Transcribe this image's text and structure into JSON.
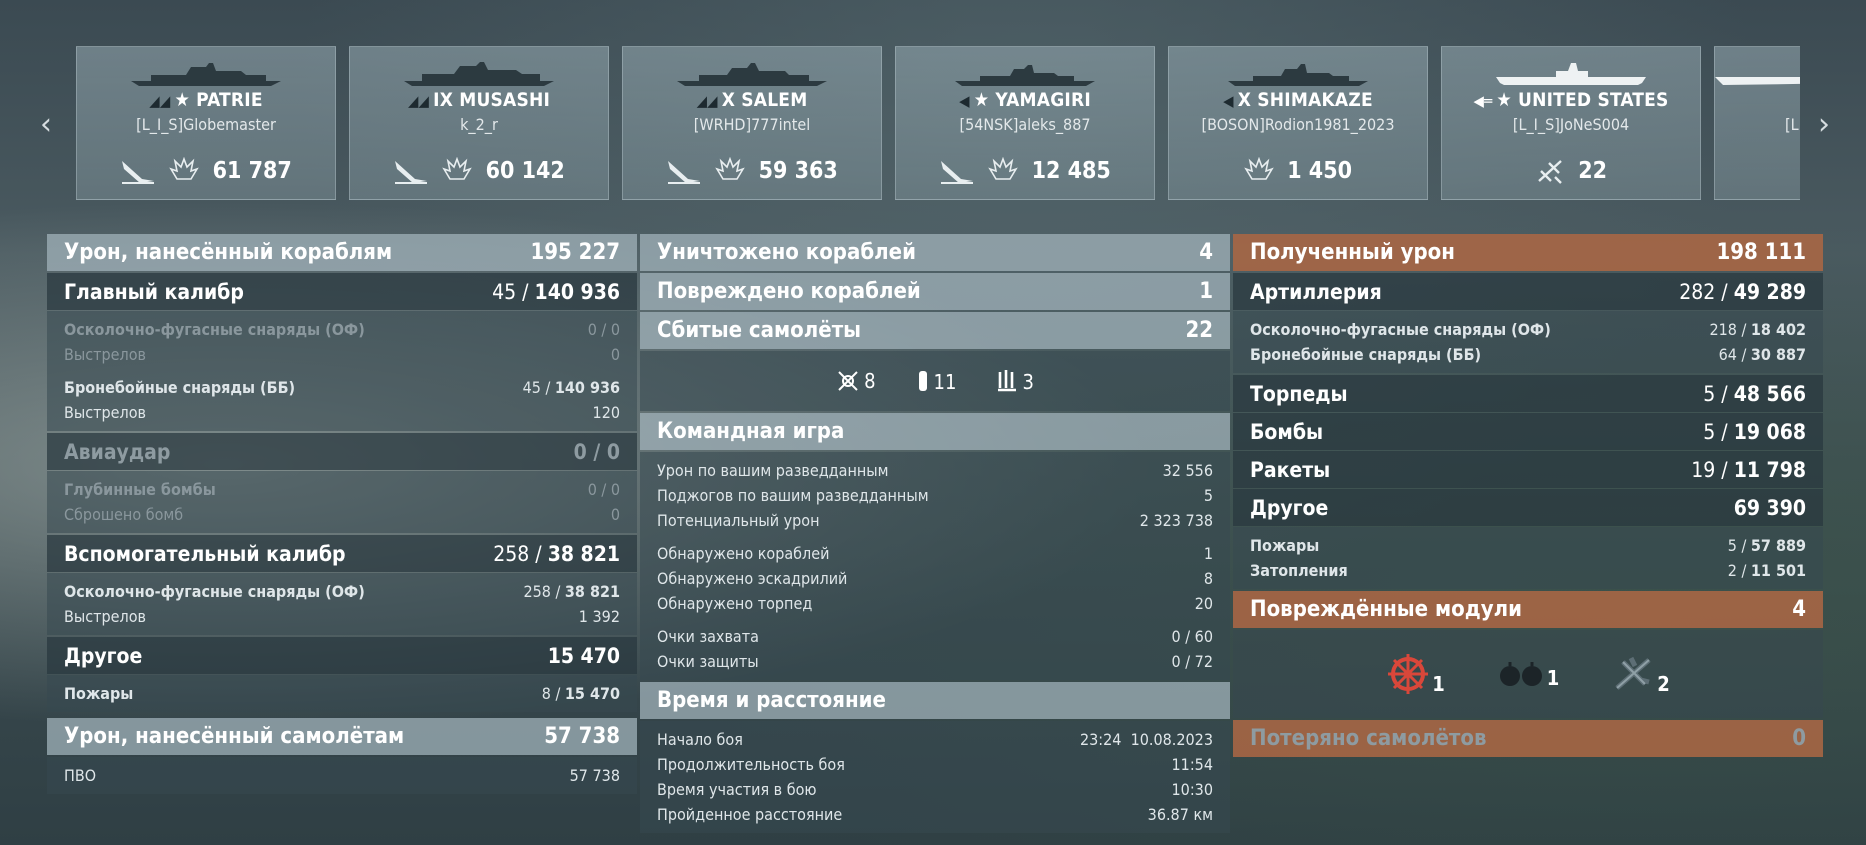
{
  "carousel": {
    "prev_icon": "chevron-left-icon",
    "next_icon": "chevron-right-icon",
    "cards": [
      {
        "tier": "★ PATRIE",
        "player": "[L_I_S]Globemaster",
        "icons": [
          "torpedo-icon",
          "fire-icon"
        ],
        "value": "61 787"
      },
      {
        "tier": "IX MUSASHI",
        "player": "k_2_r",
        "icons": [
          "torpedo-icon",
          "fire-icon"
        ],
        "value": "60 142"
      },
      {
        "tier": "X SALEM",
        "player": "[WRHD]777intel",
        "icons": [
          "torpedo-icon",
          "fire-icon"
        ],
        "value": "59 363"
      },
      {
        "tier": "★ YAMAGIRI",
        "player": "[54NSK]aleks_887",
        "icons": [
          "torpedo-icon",
          "fire-icon"
        ],
        "value": "12 485"
      },
      {
        "tier": "X SHIMAKAZE",
        "player": "[BOSON]Rodion1981_2023",
        "icons": [
          "fire-icon"
        ],
        "value": "1 450"
      },
      {
        "tier": "★ UNITED STATES",
        "player": "[L_I_S]JoNeS004",
        "icons": [
          "plane-shot-icon"
        ],
        "value": "22"
      },
      {
        "tier": "",
        "player": "[L",
        "icons": [],
        "value": ""
      }
    ]
  },
  "left": {
    "header": {
      "label": "Урон, нанесённый кораблям",
      "value": "195 227"
    },
    "main": {
      "label": "Главный калибр",
      "a": "45",
      "b": "140 936"
    },
    "main_rows": [
      {
        "label": "Осколочно-фугасные снаряды (ОФ)",
        "value": "0 / 0"
      },
      {
        "label": "Выстрелов",
        "value": "0"
      }
    ],
    "main_rows2": [
      {
        "label": "Бронебойные снаряды (ББ)",
        "a": "45",
        "b": "140 936"
      },
      {
        "label": "Выстрелов",
        "value": "120"
      }
    ],
    "air": {
      "label": "Авиаудар",
      "value": "0 / 0"
    },
    "air_rows": [
      {
        "label": "Глубинные бомбы",
        "value": "0 / 0"
      },
      {
        "label": "Сброшено бомб",
        "value": "0"
      }
    ],
    "secondary": {
      "label": "Вспомогательный калибр",
      "a": "258",
      "b": "38 821"
    },
    "secondary_rows": [
      {
        "label": "Осколочно-фугасные снаряды (ОФ)",
        "a": "258",
        "b": "38 821"
      },
      {
        "label": "Выстрелов",
        "value": "1 392"
      }
    ],
    "other": {
      "label": "Другое",
      "value": "15 470"
    },
    "other_rows": [
      {
        "label": "Пожары",
        "a": "8",
        "b": "15 470"
      }
    ],
    "planes": {
      "label": "Урон, нанесённый самолётам",
      "value": "57 738"
    },
    "planes_rows": [
      {
        "label": "ПВО",
        "value": "57 738"
      }
    ]
  },
  "mid": {
    "destroyed": {
      "label": "Уничтожено кораблей",
      "value": "4"
    },
    "damaged": {
      "label": "Повреждено кораблей",
      "value": "1"
    },
    "shot_down": {
      "label": "Сбитые самолёты",
      "value": "22"
    },
    "plane_types": [
      {
        "icon": "fighter-icon",
        "value": "8"
      },
      {
        "icon": "bomber-icon",
        "value": "11"
      },
      {
        "icon": "attack-aircraft-icon",
        "value": "3"
      }
    ],
    "team": {
      "label": "Командная игра"
    },
    "team_rows1": [
      {
        "label": "Урон по вашим разведданным",
        "value": "32 556"
      },
      {
        "label": "Поджогов по вашим разведданным",
        "value": "5"
      },
      {
        "label": "Потенциальный урон",
        "value": "2 323 738"
      }
    ],
    "team_rows2": [
      {
        "label": "Обнаружено кораблей",
        "value": "1"
      },
      {
        "label": "Обнаружено эскадрилий",
        "value": "8"
      },
      {
        "label": "Обнаружено торпед",
        "value": "20"
      }
    ],
    "team_rows3": [
      {
        "label": "Очки захвата",
        "value": "0 / 60"
      },
      {
        "label": "Очки защиты",
        "value": "0 / 72"
      }
    ],
    "time": {
      "label": "Время и расстояние"
    },
    "time_rows": [
      {
        "label": "Начало боя",
        "value": "23:24  10.08.2023"
      },
      {
        "label": "Продолжительность боя",
        "value": "11:54"
      },
      {
        "label": "Время участия в бою",
        "value": "10:30"
      },
      {
        "label": "Пройденное расстояние",
        "value": "36.87 км"
      }
    ]
  },
  "right": {
    "header": {
      "label": "Полученный урон",
      "value": "198 111"
    },
    "artillery": {
      "label": "Артиллерия",
      "a": "282",
      "b": "49 289"
    },
    "artillery_rows": [
      {
        "label": "Осколочно-фугасные снаряды (ОФ)",
        "a": "218",
        "b": "18 402"
      },
      {
        "label": "Бронебойные снаряды (ББ)",
        "a": "64",
        "b": "30 887"
      }
    ],
    "torpedoes": {
      "label": "Торпеды",
      "a": "5",
      "b": "48 566"
    },
    "bombs": {
      "label": "Бомбы",
      "a": "5",
      "b": "19 068"
    },
    "rockets": {
      "label": "Ракеты",
      "a": "19",
      "b": "11 798"
    },
    "other": {
      "label": "Другое",
      "value": "69 390"
    },
    "other_rows": [
      {
        "label": "Пожары",
        "a": "5",
        "b": "57 889"
      },
      {
        "label": "Затопления",
        "a": "2",
        "b": "11 501"
      }
    ],
    "modules": {
      "label": "Повреждённые модули",
      "value": "4"
    },
    "module_icons": [
      {
        "icon": "steering-gear-icon",
        "value": "1"
      },
      {
        "icon": "depth-charge-icon",
        "value": "1"
      },
      {
        "icon": "aa-gun-icon",
        "value": "2"
      }
    ],
    "lost": {
      "label": "Потеряно самолётов",
      "value": "0"
    }
  }
}
